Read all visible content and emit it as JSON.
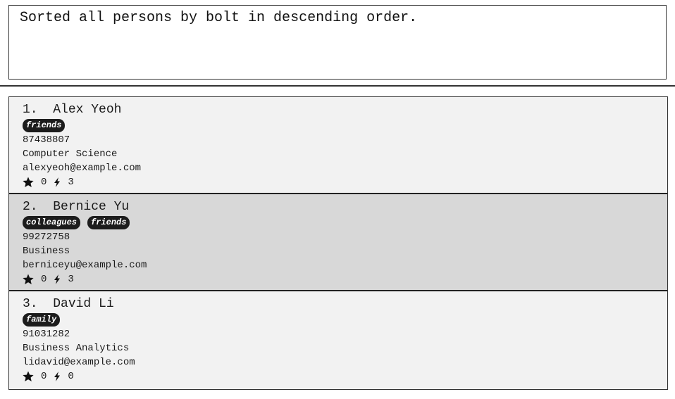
{
  "result": {
    "message": "Sorted all persons by bolt in descending order."
  },
  "persons": [
    {
      "index": "1.",
      "name": "Alex Yeoh",
      "tags": [
        "friends"
      ],
      "phone": "87438807",
      "major": "Computer Science",
      "email": "alexyeoh@example.com",
      "stars": "0",
      "bolts": "3"
    },
    {
      "index": "2.",
      "name": "Bernice Yu",
      "tags": [
        "colleagues",
        "friends"
      ],
      "phone": "99272758",
      "major": "Business",
      "email": "berniceyu@example.com",
      "stars": "0",
      "bolts": "3"
    },
    {
      "index": "3.",
      "name": "David Li",
      "tags": [
        "family"
      ],
      "phone": "91031282",
      "major": "Business Analytics",
      "email": "lidavid@example.com",
      "stars": "0",
      "bolts": "0"
    }
  ],
  "icons": {
    "star": "star-icon",
    "bolt": "bolt-icon"
  }
}
